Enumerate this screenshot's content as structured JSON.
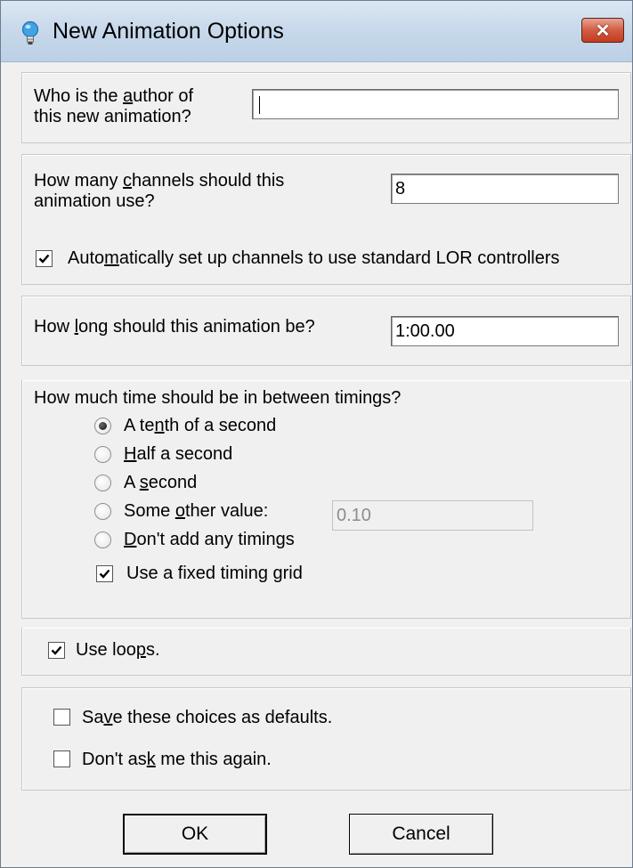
{
  "window": {
    "title": "New Animation Options",
    "close_glyph": "✕",
    "icon": "lightbulb-icon"
  },
  "author": {
    "label_line1": "Who is the author of",
    "label_line2": "this new animation?",
    "value": ""
  },
  "channels": {
    "label_line1": "How many channels should this",
    "label_line2": "animation use?",
    "value": "8",
    "auto_setup_label": "Automatically set up channels to use standard LOR controllers",
    "auto_setup_checked": true
  },
  "length": {
    "label": "How long should this animation be?",
    "value": "1:00.00"
  },
  "timings": {
    "label": "How much time should be in between timings?",
    "options": [
      {
        "label": "A tenth of a second",
        "selected": true
      },
      {
        "label": "Half a second",
        "selected": false
      },
      {
        "label": "A second",
        "selected": false
      },
      {
        "label": "Some other value:",
        "selected": false
      },
      {
        "label": "Don't add any timings",
        "selected": false
      }
    ],
    "other_value": "0.10",
    "fixed_grid_label": "Use a fixed timing grid",
    "fixed_grid_checked": true
  },
  "loops": {
    "label": "Use loops.",
    "checked": true
  },
  "defaults": {
    "save_label": "Save these choices as defaults.",
    "save_checked": false,
    "dont_ask_label": "Don't ask me this again.",
    "dont_ask_checked": false
  },
  "buttons": {
    "ok": "OK",
    "cancel": "Cancel"
  }
}
